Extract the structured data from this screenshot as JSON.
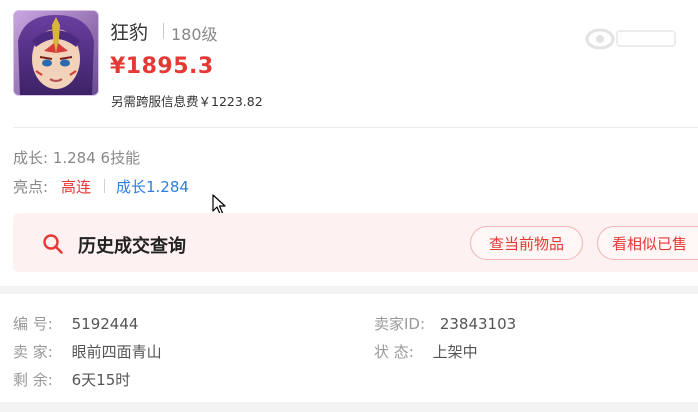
{
  "item": {
    "name": "狂豹",
    "level": "180级",
    "price": "¥1895.3",
    "extra_fee": "另需跨服信息费￥1223.82"
  },
  "stats": {
    "growth_text": "成长: 1.284 6技能",
    "highlight_label": "亮点:",
    "highlight_red": "高连",
    "highlight_blue": "成长1.284"
  },
  "history": {
    "title": "历史成交查询",
    "btn_current": "查当前物品",
    "btn_similar": "看相似已售"
  },
  "details": {
    "id_label": "编 号:",
    "id_value": "5192444",
    "seller_id_label": "卖家ID:",
    "seller_id_value": "23843103",
    "seller_label": "卖 家:",
    "seller_value": "眼前四面青山",
    "status_label": "状 态:",
    "status_value": "上架中",
    "remaining_label": "剩 余:",
    "remaining_value": "6天15时"
  },
  "colors": {
    "price": "#e53935",
    "highlight_red": "#e53935",
    "highlight_blue": "#2f7de1",
    "history_bg": "#fdf1f1"
  },
  "icons": {
    "search": "search-icon",
    "cursor": "mouse-cursor-icon",
    "avatar": "character-portrait"
  }
}
